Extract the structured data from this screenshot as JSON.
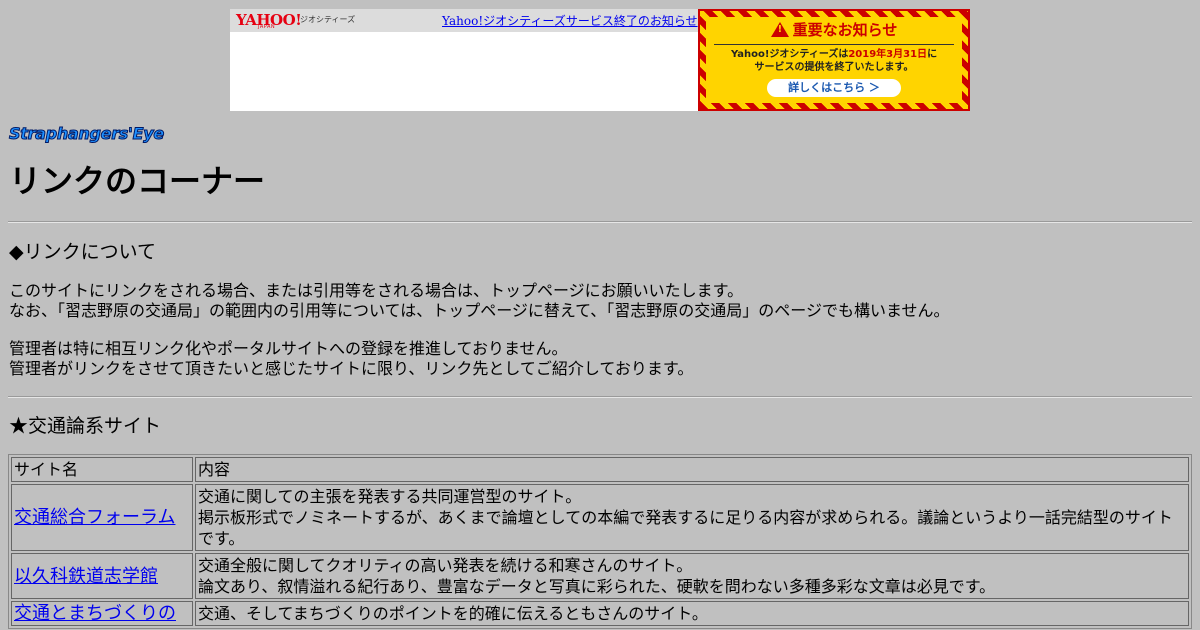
{
  "banner": {
    "logo": "YAHOO!",
    "logo_sub": "JAPAN",
    "brand": "ジオシティーズ",
    "link_text": "Yahoo!ジオシティーズサービス終了のお知らせ",
    "notice": {
      "title": "重要なお知らせ",
      "line1_pre": "Yahoo!ジオシティーズは",
      "line1_date": "2019年3月31日",
      "line1_post": "に",
      "line2": "サービスの提供を終了いたします。",
      "button": "詳しくはこちら ＞"
    },
    "colors": {
      "alert_red": "#cc0000",
      "alert_yellow": "#ffd400",
      "link_blue": "#1a58b0"
    }
  },
  "site_logo": "Straphangers'Eye",
  "page_title": "リンクのコーナー",
  "section1": {
    "heading": "◆リンクについて",
    "para1_line1": "このサイトにリンクをされる場合、または引用等をされる場合は、トップページにお願いいたします。",
    "para1_line2": "なお、「習志野原の交通局」の範囲内の引用等については、トップページに替えて、「習志野原の交通局」のページでも構いません。",
    "para2_line1": "管理者は特に相互リンク化やポータルサイトへの登録を推進しておりません。",
    "para2_line2": "管理者がリンクをさせて頂きたいと感じたサイトに限り、リンク先としてご紹介しております。"
  },
  "section2": {
    "heading": "★交通論系サイト",
    "table": {
      "headers": [
        "サイト名",
        "内容"
      ],
      "rows": [
        {
          "site": "交通総合フォーラム",
          "desc": [
            "交通に関しての主張を発表する共同運営型のサイト。",
            "掲示板形式でノミネートするが、あくまで論壇としての本編で発表するに足りる内容が求められる。議論というより一話完結型のサイト",
            "です。"
          ]
        },
        {
          "site": "以久科鉄道志学館",
          "desc": [
            "交通全般に関してクオリティの高い発表を続ける和寒さんのサイト。",
            "論文あり、叙情溢れる紀行あり、豊富なデータと写真に彩られた、硬軟を問わない多種多彩な文章は必見です。"
          ]
        },
        {
          "site": "交通とまちづくりの",
          "desc": [
            "交通、そしてまちづくりのポイントを的確に伝えるともさんのサイト。",
            ""
          ]
        }
      ]
    }
  }
}
